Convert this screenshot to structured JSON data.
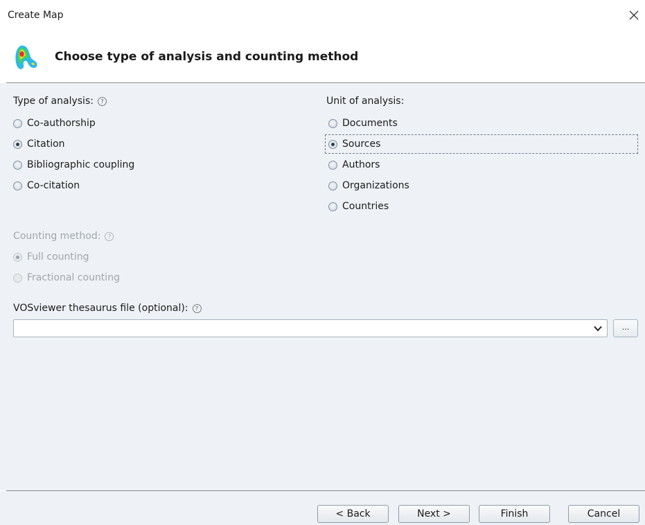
{
  "window": {
    "title": "Create Map",
    "close_glyph": "✕"
  },
  "header": {
    "title": "Choose type of analysis and counting method",
    "icon": "vosviewer-logo-icon"
  },
  "type_of_analysis": {
    "label": "Type of analysis:",
    "options": [
      "Co-authorship",
      "Citation",
      "Bibliographic coupling",
      "Co-citation"
    ],
    "selected": "Citation"
  },
  "unit_of_analysis": {
    "label": "Unit of analysis:",
    "options": [
      "Documents",
      "Sources",
      "Authors",
      "Organizations",
      "Countries"
    ],
    "selected": "Sources"
  },
  "counting_method": {
    "label": "Counting method:",
    "options": [
      "Full counting",
      "Fractional counting"
    ],
    "selected": "Full counting",
    "enabled": false
  },
  "thesaurus": {
    "label": "VOSviewer thesaurus file (optional):",
    "value": "",
    "browse_label": "..."
  },
  "help_glyph": "?",
  "footer": {
    "back_label": "< Back",
    "next_label": "Next >",
    "finish_label": "Finish",
    "cancel_label": "Cancel"
  },
  "colors": {
    "content_bg": "#eef2f6",
    "radio_dot": "#2c3e50",
    "disabled_text": "#a0a6ac"
  }
}
